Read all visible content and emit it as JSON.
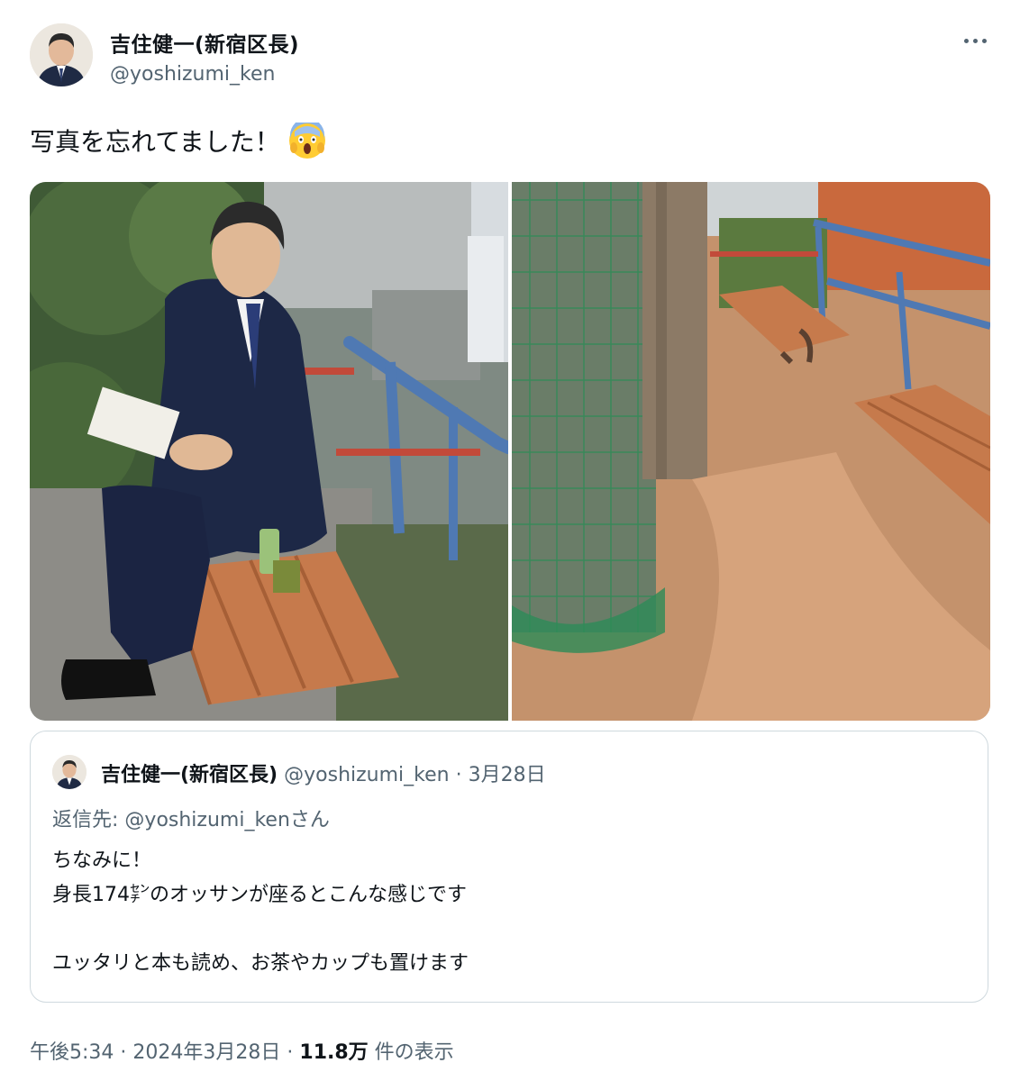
{
  "author": {
    "display_name": "吉住健一(新宿区長)",
    "handle": "@yoshizumi_ken"
  },
  "tweet": {
    "text": "写真を忘れてました！",
    "emoji_icon": "face-screaming-in-fear-icon"
  },
  "media": {
    "count": 2
  },
  "quote": {
    "display_name": "吉住健一(新宿区長)",
    "handle": "@yoshizumi_ken",
    "separator": "·",
    "date": "3月28日",
    "reply_to_label": "返信先:",
    "reply_to_handle": "@yoshizumi_kenさん",
    "lines": [
      "ちなみに！",
      "身長174㌢のオッサンが座るとこんな感じです",
      "",
      "ユッタリと本も読め、お茶やカップも置けます"
    ]
  },
  "meta": {
    "time": "午後5:34",
    "separator1": "·",
    "date": "2024年3月28日",
    "separator2": "·",
    "views_count": "11.8万",
    "views_label": "件の表示"
  },
  "colors": {
    "text": "#0f1419",
    "secondary_text": "#536471",
    "border": "#cfd9de"
  }
}
